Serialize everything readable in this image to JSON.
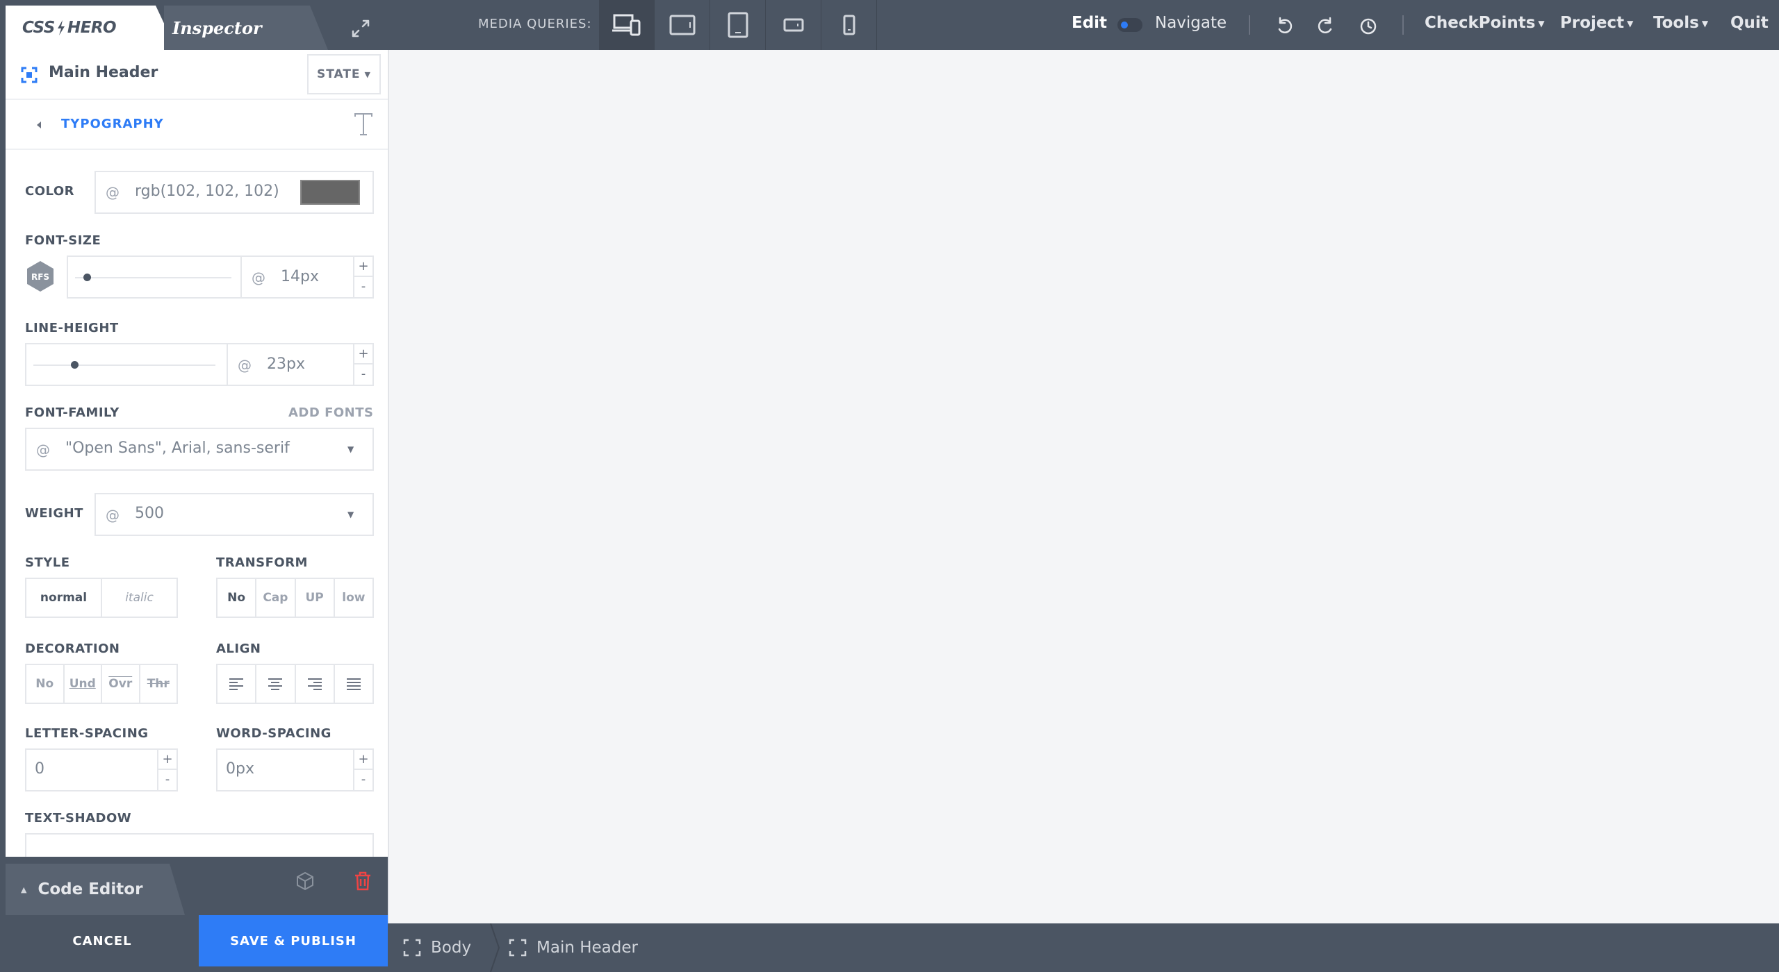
{
  "topbar": {
    "logo": {
      "left": "CSS",
      "right": "HERO"
    },
    "inspector_label": "Inspector",
    "media_queries_label": "MEDIA QUERIES:",
    "media_queries": [
      {
        "icon": "desktop-mobile-icon",
        "active": true
      },
      {
        "icon": "tablet-landscape-icon",
        "active": false
      },
      {
        "icon": "tablet-portrait-icon",
        "active": false
      },
      {
        "icon": "phone-landscape-icon",
        "active": false
      },
      {
        "icon": "phone-portrait-icon",
        "active": false
      }
    ],
    "edit_label": "Edit",
    "navigate_label": "Navigate",
    "menus": [
      "CheckPoints",
      "Project",
      "Tools"
    ],
    "quit_label": "Quit",
    "accent_color": "#2e7cf6"
  },
  "panel": {
    "element_name": "Main Header",
    "state_label": "STATE",
    "section_title": "TYPOGRAPHY",
    "color": {
      "label": "COLOR",
      "value": "rgb(102, 102, 102)",
      "swatch": "#666666"
    },
    "font_size": {
      "label": "FONT-SIZE",
      "badge": "RFS",
      "value": "14px",
      "plus": "+",
      "minus": "-"
    },
    "line_height": {
      "label": "LINE-HEIGHT",
      "value": "23px",
      "plus": "+",
      "minus": "-"
    },
    "font_family": {
      "label": "FONT-FAMILY",
      "add_fonts": "ADD FONTS",
      "value": "\"Open Sans\", Arial, sans-serif"
    },
    "weight": {
      "label": "WEIGHT",
      "value": "500"
    },
    "style": {
      "label": "STYLE",
      "options": [
        "normal",
        "italic"
      ],
      "selected": "normal"
    },
    "transform": {
      "label": "TRANSFORM",
      "options": [
        "No",
        "Cap",
        "UP",
        "low"
      ],
      "selected": "No"
    },
    "decoration": {
      "label": "DECORATION",
      "options": [
        "No",
        "Und",
        "Ovr",
        "Thr"
      ]
    },
    "align": {
      "label": "ALIGN"
    },
    "letter_spacing": {
      "label": "LETTER-SPACING",
      "value": "0",
      "plus": "+",
      "minus": "-"
    },
    "word_spacing": {
      "label": "WORD-SPACING",
      "value": "0px",
      "plus": "+",
      "minus": "-"
    },
    "text_shadow": {
      "label": "TEXT-SHADOW"
    },
    "at_symbol": "@"
  },
  "code_editor": {
    "label": "Code Editor"
  },
  "actions": {
    "cancel": "CANCEL",
    "save": "SAVE & PUBLISH"
  },
  "breadcrumb": [
    "Body",
    "Main Header"
  ]
}
